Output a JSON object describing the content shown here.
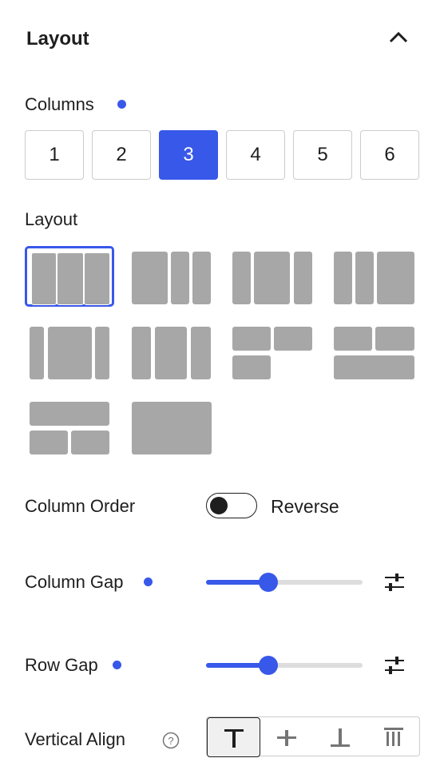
{
  "panel": {
    "title": "Layout"
  },
  "columns": {
    "label": "Columns",
    "options": [
      "1",
      "2",
      "3",
      "4",
      "5",
      "6"
    ],
    "selected": "3"
  },
  "layout_section": {
    "label": "Layout"
  },
  "column_order": {
    "label": "Column Order",
    "toggle_label": "Reverse",
    "enabled": false
  },
  "column_gap": {
    "label": "Column Gap",
    "value_fraction": 0.4
  },
  "row_gap": {
    "label": "Row Gap",
    "value_fraction": 0.4
  },
  "vertical_align": {
    "label": "Vertical Align",
    "selected": "top"
  },
  "colors": {
    "accent": "#3858e9",
    "block": "#a7a7a7",
    "text": "#1e1e1e"
  }
}
